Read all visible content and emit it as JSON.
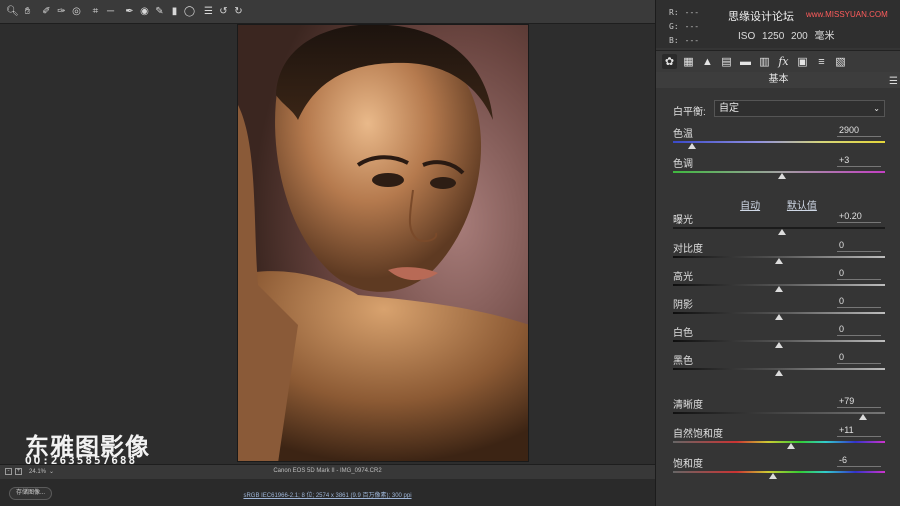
{
  "toolbar": {
    "tools": [
      "zoom-icon",
      "hand-icon",
      "white-balance-icon",
      "color-sampler-icon",
      "target-adjust-icon",
      "crop-icon",
      "straighten-icon",
      "spot-removal-icon",
      "red-eye-icon",
      "adjustment-brush-icon",
      "graduated-filter-icon",
      "radial-filter-icon",
      "preferences-icon",
      "rotate-left-icon",
      "rotate-right-icon"
    ]
  },
  "watermark": {
    "brand": "东雅图影像",
    "qq": "QQ:2635857688"
  },
  "status": {
    "zoom": "24.1%",
    "filename": "Canon EOS 5D Mark II  -  IMG_0974.CR2"
  },
  "footer": {
    "save_label": "存储图像...",
    "workflow": "sRGB IEC61966-2.1; 8 位; 2574 x 3861 (9.9 百万像素); 300 ppi"
  },
  "histogram": {
    "r_label": "R:",
    "g_label": "G:",
    "b_label": "B:",
    "r_val": "---",
    "g_val": "---",
    "b_val": "---",
    "watermark": "思缘设计论坛",
    "watermark_url": "www.MISSYUAN.COM",
    "camera_info": "ISO 1250  200 毫米"
  },
  "panel": {
    "section_title": "基本",
    "white_balance_label": "白平衡:",
    "white_balance_value": "自定",
    "auto_label": "自动",
    "default_label": "默认值",
    "sliders": [
      {
        "name": "temperature",
        "label": "色温",
        "value": "2900",
        "pos": 0.09
      },
      {
        "name": "tint",
        "label": "色调",
        "value": "+3",
        "pos": 0.515
      },
      {
        "name": "exposure",
        "label": "曝光",
        "value": "+0.20",
        "pos": 0.515
      },
      {
        "name": "contrast",
        "label": "对比度",
        "value": "0",
        "pos": 0.5
      },
      {
        "name": "highlights",
        "label": "高光",
        "value": "0",
        "pos": 0.5
      },
      {
        "name": "shadows",
        "label": "阴影",
        "value": "0",
        "pos": 0.5
      },
      {
        "name": "whites",
        "label": "白色",
        "value": "0",
        "pos": 0.5
      },
      {
        "name": "blacks",
        "label": "黑色",
        "value": "0",
        "pos": 0.5
      },
      {
        "name": "clarity",
        "label": "清晰度",
        "value": "+79",
        "pos": 0.895
      },
      {
        "name": "vibrance",
        "label": "自然饱和度",
        "value": "+11",
        "pos": 0.555
      },
      {
        "name": "saturation",
        "label": "饱和度",
        "value": "-6",
        "pos": 0.47
      }
    ]
  }
}
